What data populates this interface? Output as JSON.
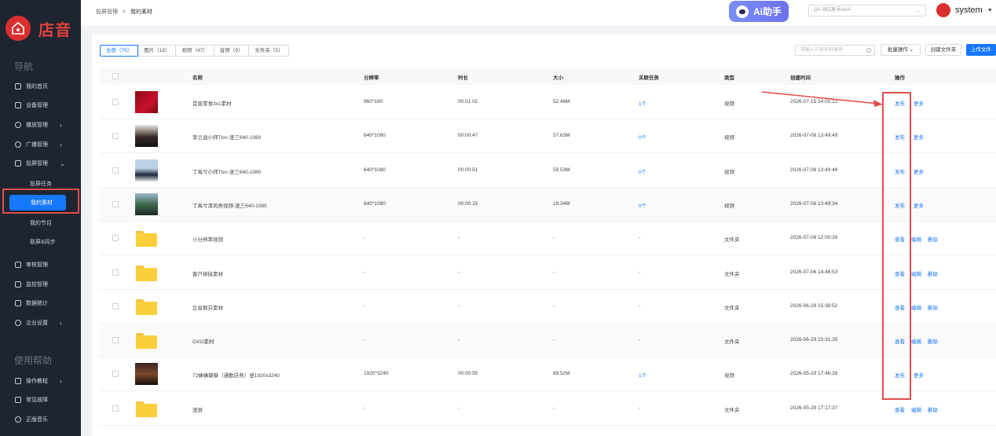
{
  "sidebar": {
    "logo_text": "店音",
    "section_nav": "导航",
    "section_help": "使用帮助",
    "items": [
      {
        "label": "我的首页",
        "icon": "home-icon"
      },
      {
        "label": "设备管理",
        "icon": "device-icon"
      },
      {
        "label": "播放管理",
        "icon": "play-icon",
        "arrow": "›"
      },
      {
        "label": "广播管理",
        "icon": "broadcast-icon",
        "arrow": "›"
      },
      {
        "label": "投屏管理",
        "icon": "screen-icon",
        "arrow": "⌄"
      }
    ],
    "sub_items": [
      "投屏任务",
      "我的素材",
      "我的节目",
      "联屏&同步"
    ],
    "items2": [
      {
        "label": "审核管理",
        "icon": "audit-icon"
      },
      {
        "label": "监控管理",
        "icon": "monitor-icon"
      },
      {
        "label": "数据统计",
        "icon": "stats-icon"
      },
      {
        "label": "企业设置",
        "icon": "settings-icon",
        "arrow": "›"
      }
    ],
    "help_items": [
      {
        "label": "操作教程",
        "icon": "tutorial-icon",
        "arrow": "›"
      },
      {
        "label": "常见故障",
        "icon": "faq-icon"
      },
      {
        "label": "正版音乐",
        "icon": "music-icon"
      }
    ]
  },
  "header": {
    "breadcrumb_parent": "投屏管理",
    "breadcrumb_sep": ">",
    "breadcrumb_current": "我的素材",
    "ai_label": "Ai助手",
    "account_select": "QA-测试账号AAA",
    "user_name": "system"
  },
  "toolbar": {
    "tabs": [
      "全部（79）",
      "图片（18）",
      "视频（47）",
      "音频（9）",
      "文件夹（5）"
    ],
    "search_placeholder": "请输入内容名称搜索",
    "batch_label": "批量操作",
    "create_folder_label": "创建文件夹",
    "upload_label": "上传文件"
  },
  "table": {
    "columns": [
      "名称",
      "分辨率",
      "时长",
      "大小",
      "关联任务",
      "类型",
      "创建时间",
      "操作"
    ],
    "rows": [
      {
        "name": "首直零食3x1素材",
        "res": "960*180",
        "dur": "00:01:02",
        "size": "52.48M",
        "task": "1个",
        "type": "视频",
        "time": "2026-07-15 14:01:12",
        "ops": [
          "发布",
          "更多"
        ],
        "thumb": "video"
      },
      {
        "name": "李兰迪小师Ttvc-竖三640-1080",
        "res": "640*1080",
        "dur": "00:00:47",
        "size": "57.63M",
        "task": "0个",
        "type": "视频",
        "time": "2026-07-08 13:49:49",
        "ops": [
          "发布",
          "更多"
        ],
        "thumb": "video"
      },
      {
        "name": "丁禹兮小师Ttvc-竖三640-1080",
        "res": "640*1080",
        "dur": "00:00:51",
        "size": "59.53M",
        "task": "0个",
        "type": "视频",
        "time": "2026-07-08 13:49:48",
        "ops": [
          "发布",
          "更多"
        ],
        "thumb": "video"
      },
      {
        "name": "丁禹兮清风亮视频-竖三640-1080",
        "res": "640*1080",
        "dur": "00:00:15",
        "size": "19.34M",
        "task": "0个",
        "type": "视频",
        "time": "2026-07-08 13:49:34",
        "ops": [
          "发布",
          "更多"
        ],
        "thumb": "video"
      },
      {
        "name": "小分辨率视频",
        "res": "-",
        "dur": "-",
        "size": "-",
        "task": "-",
        "type": "文件夹",
        "time": "2026-07-08 12:00:26",
        "ops": [
          "查看",
          "编辑",
          "删除"
        ],
        "thumb": "folder"
      },
      {
        "name": "客户拼接素材",
        "res": "-",
        "dur": "-",
        "size": "-",
        "task": "-",
        "type": "文件夹",
        "time": "2026-07-06 14:46:53",
        "ops": [
          "查看",
          "编辑",
          "删除"
        ],
        "thumb": "folder"
      },
      {
        "name": "比音勒芬素材",
        "res": "-",
        "dur": "-",
        "size": "-",
        "task": "-",
        "type": "文件夹",
        "time": "2026-06-29 15:38:52",
        "ops": [
          "查看",
          "编辑",
          "删除"
        ],
        "thumb": "folder"
      },
      {
        "name": "GXG素材",
        "res": "-",
        "dur": "-",
        "size": "-",
        "task": "-",
        "type": "文件夹",
        "time": "2026-06-29 15:31:35",
        "ops": [
          "查看",
          "编辑",
          "删除"
        ],
        "thumb": "folder"
      },
      {
        "name": "72蜂蜂朝泰（通勤店务）竖1920x3240",
        "res": "1920*3240",
        "dur": "00:00:55",
        "size": "69.52M",
        "task": "1个",
        "type": "视频",
        "time": "2026-05-29 17:46:26",
        "ops": [
          "发布",
          "更多"
        ],
        "thumb": "video"
      },
      {
        "name": "竖屏",
        "res": "-",
        "dur": "-",
        "size": "-",
        "task": "-",
        "type": "文件夹",
        "time": "2026-05-29 17:17:37",
        "ops": [
          "查看",
          "编辑",
          "删除"
        ],
        "thumb": "folder"
      }
    ]
  },
  "colors": {
    "accent": "#1677ff",
    "brand": "#d9302e",
    "annotation": "#e34d4a"
  }
}
